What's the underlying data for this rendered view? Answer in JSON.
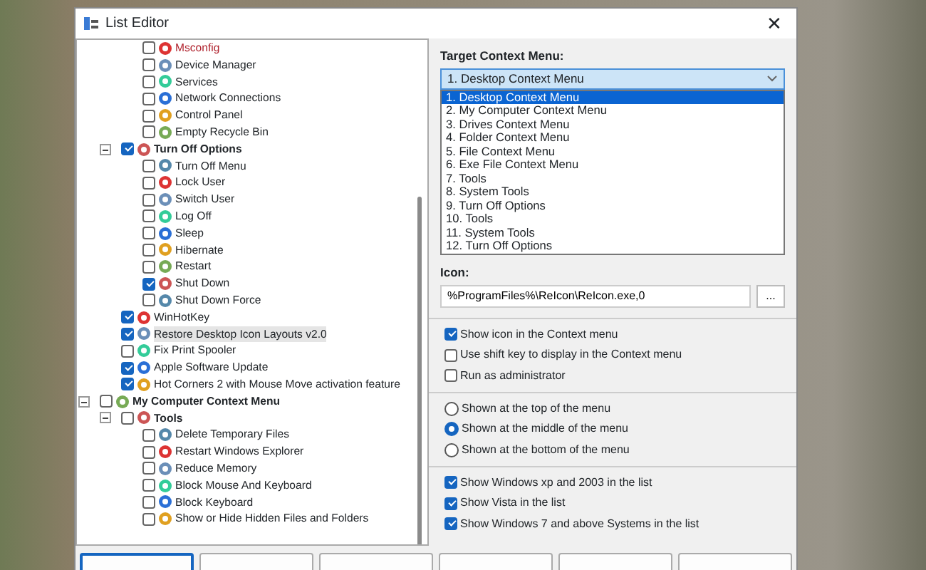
{
  "window": {
    "title": "List Editor",
    "close": "✕"
  },
  "tree": [
    {
      "children": [
        {
          "children": [
            {
              "label": "Msconfig",
              "checked": false,
              "selected": false,
              "color": "#b0242f"
            },
            {
              "label": "Device Manager",
              "checked": false,
              "selected": false
            },
            {
              "label": "Services",
              "checked": false,
              "selected": false
            },
            {
              "label": "Network Connections",
              "checked": false,
              "selected": false
            },
            {
              "label": "Control Panel",
              "checked": false,
              "selected": false
            },
            {
              "label": "Empty Recycle Bin",
              "checked": false,
              "selected": false
            }
          ]
        },
        {
          "label": "Turn Off Options",
          "checked": true,
          "selected": false,
          "expanded": true,
          "children": [
            {
              "label": "Turn Off Menu",
              "checked": false,
              "selected": false
            },
            {
              "label": "Lock User",
              "checked": false,
              "selected": false
            },
            {
              "label": "Switch User",
              "checked": false,
              "selected": false
            },
            {
              "label": "Log Off",
              "checked": false,
              "selected": false
            },
            {
              "label": "Sleep",
              "checked": false,
              "selected": false
            },
            {
              "label": "Hibernate",
              "checked": false,
              "selected": false
            },
            {
              "label": "Restart",
              "checked": false,
              "selected": false
            },
            {
              "label": "Shut Down",
              "checked": true,
              "selected": false
            },
            {
              "label": "Shut Down Force",
              "checked": false,
              "selected": false
            }
          ]
        },
        {
          "label": "WinHotKey",
          "checked": true,
          "selected": false
        },
        {
          "label": "Restore Desktop Icon Layouts v2.0",
          "checked": true,
          "selected": true
        },
        {
          "label": "Fix Print Spooler",
          "checked": false,
          "selected": false
        },
        {
          "label": "Apple Software Update",
          "checked": true,
          "selected": false
        },
        {
          "label": "Hot Corners 2 with Mouse Move activation feature",
          "checked": true,
          "selected": false
        }
      ]
    },
    {
      "label": "My Computer Context Menu",
      "checked": false,
      "selected": false,
      "expanded": true,
      "children": [
        {
          "label": "Tools",
          "checked": false,
          "selected": false,
          "expanded": true,
          "children": [
            {
              "label": "Delete Temporary Files",
              "checked": false,
              "selected": false
            },
            {
              "label": "Restart Windows Explorer",
              "checked": false,
              "selected": false
            },
            {
              "label": "Reduce Memory",
              "checked": false,
              "selected": false
            },
            {
              "label": "Block Mouse And Keyboard",
              "checked": false,
              "selected": false
            },
            {
              "label": "Block Keyboard",
              "checked": false,
              "selected": false
            },
            {
              "label": "Show or Hide Hidden Files and Folders",
              "checked": false,
              "selected": false
            }
          ]
        }
      ]
    }
  ],
  "target": {
    "label": "Target Context Menu:",
    "value": "1. Desktop Context Menu",
    "expanded": true,
    "options": [
      {
        "label": "1. Desktop Context Menu",
        "selected": true
      },
      {
        "label": "2. My Computer Context Menu",
        "selected": false
      },
      {
        "label": "3. Drives Context Menu",
        "selected": false
      },
      {
        "label": "4. Folder Context Menu",
        "selected": false
      },
      {
        "label": "5. File Context Menu",
        "selected": false
      },
      {
        "label": "6. Exe File Context Menu",
        "selected": false
      },
      {
        "label": "7. Tools",
        "selected": false
      },
      {
        "label": "8. System Tools",
        "selected": false
      },
      {
        "label": "9. Turn Off Options",
        "selected": false
      },
      {
        "label": "10. Tools",
        "selected": false
      },
      {
        "label": "11. System Tools",
        "selected": false
      },
      {
        "label": "12. Turn Off Options",
        "selected": false
      }
    ]
  },
  "icon": {
    "label": "Icon:",
    "value": "%ProgramFiles%\\ReIcon\\ReIcon.exe,0",
    "browse": "..."
  },
  "options": [
    {
      "label": "Show icon in the Context menu",
      "checked": true
    },
    {
      "label": "Use shift key to display in the Context menu",
      "checked": false
    },
    {
      "label": "Run as administrator",
      "checked": false
    }
  ],
  "position": [
    {
      "label": "Shown at the top of the menu",
      "selected": false
    },
    {
      "label": "Shown at the middle of the menu",
      "selected": true
    },
    {
      "label": "Shown at the bottom of the menu",
      "selected": false
    }
  ],
  "systems": [
    {
      "label": "Show Windows xp  and 2003 in the list",
      "checked": true
    },
    {
      "label": "Show Vista in the list",
      "checked": true
    },
    {
      "label": "Show Windows 7 and above Systems in the list",
      "checked": true
    }
  ],
  "buttons": [
    {
      "primary": true
    },
    {
      "primary": false
    },
    {
      "primary": false
    },
    {
      "primary": false
    },
    {
      "primary": false
    },
    {
      "primary": false
    }
  ]
}
